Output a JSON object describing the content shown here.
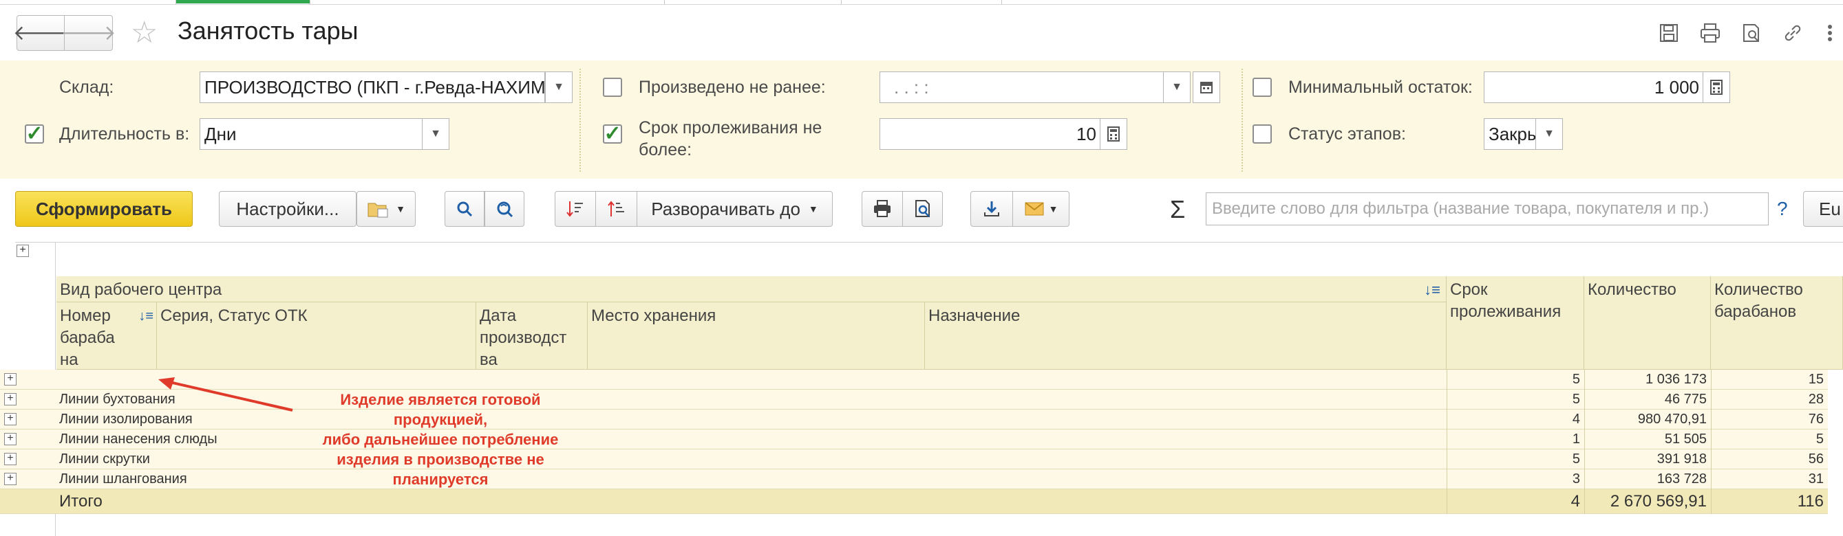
{
  "window": {
    "title": "Занятость тары",
    "back_glyph": "🡐",
    "forward_glyph": "🡒",
    "star_glyph": "☆",
    "toolbar_icons": [
      "save-icon",
      "print-icon",
      "preview-icon",
      "link-icon",
      "more-icon"
    ]
  },
  "filters": {
    "warehouse_label": "Склад:",
    "warehouse_value": "ПРОИЗВОДСТВО (ПКП - г.Ревда-НАХИМ",
    "duration_label": "Длительность в:",
    "duration_value": "Дни",
    "duration_checked": true,
    "produced_label": "Произведено не ранее:",
    "produced_value": ".   .       :   :",
    "produced_checked": false,
    "storage_label_line1": "Срок пролеживания не",
    "storage_label_line2": "более:",
    "storage_value": "10",
    "storage_checked": true,
    "min_label": "Минимальный остаток:",
    "min_value": "1 000",
    "min_checked": false,
    "stage_label": "Статус этапов:",
    "stage_value": "Закры",
    "stage_checked": false
  },
  "toolbar": {
    "generate_label": "Сформировать",
    "settings_label": "Настройки...",
    "expand_label": "Разворачивать до",
    "search_placeholder": "Введите слово для фильтра (название товара, покупателя и пр.)",
    "sigma": "Σ",
    "help": "?",
    "cut_label": "Eu"
  },
  "table": {
    "group_header": "Вид рабочего центра",
    "col_drum_number": "Номер бараба на",
    "col_series": "Серия, Статус ОТК",
    "col_prod_date": "Дата производст ва",
    "col_storage_place": "Место хранения",
    "col_purpose": "Назначение",
    "col_storage_days": "Срок пролеживания",
    "col_quantity": "Количество",
    "col_drums": "Количество барабанов",
    "rows": [
      {
        "name": "",
        "days": "5",
        "qty": "1 036 173",
        "drums": "15"
      },
      {
        "name": "Линии бухтования",
        "days": "5",
        "qty": "46 775",
        "drums": "28"
      },
      {
        "name": "Линии изолирования",
        "days": "4",
        "qty": "980 470,91",
        "drums": "76"
      },
      {
        "name": "Линии нанесения слюды",
        "days": "1",
        "qty": "51 505",
        "drums": "5"
      },
      {
        "name": "Линии скрутки",
        "days": "5",
        "qty": "391 918",
        "drums": "56"
      },
      {
        "name": "Линии шлангования",
        "days": "3",
        "qty": "163 728",
        "drums": "31"
      }
    ],
    "total": {
      "label": "Итого",
      "days": "4",
      "qty": "2 670 569,91",
      "drums": "116"
    }
  },
  "annotation": {
    "line1": "Изделие является готовой",
    "line2": "продукцией,",
    "line3": "либо дальнейшее потребление",
    "line4": "изделия в производстве не",
    "line5": "планируется"
  },
  "colors": {
    "accent": "#f0c419",
    "annotation": "#e03a2a",
    "filter_bg": "#fcf8e1"
  }
}
